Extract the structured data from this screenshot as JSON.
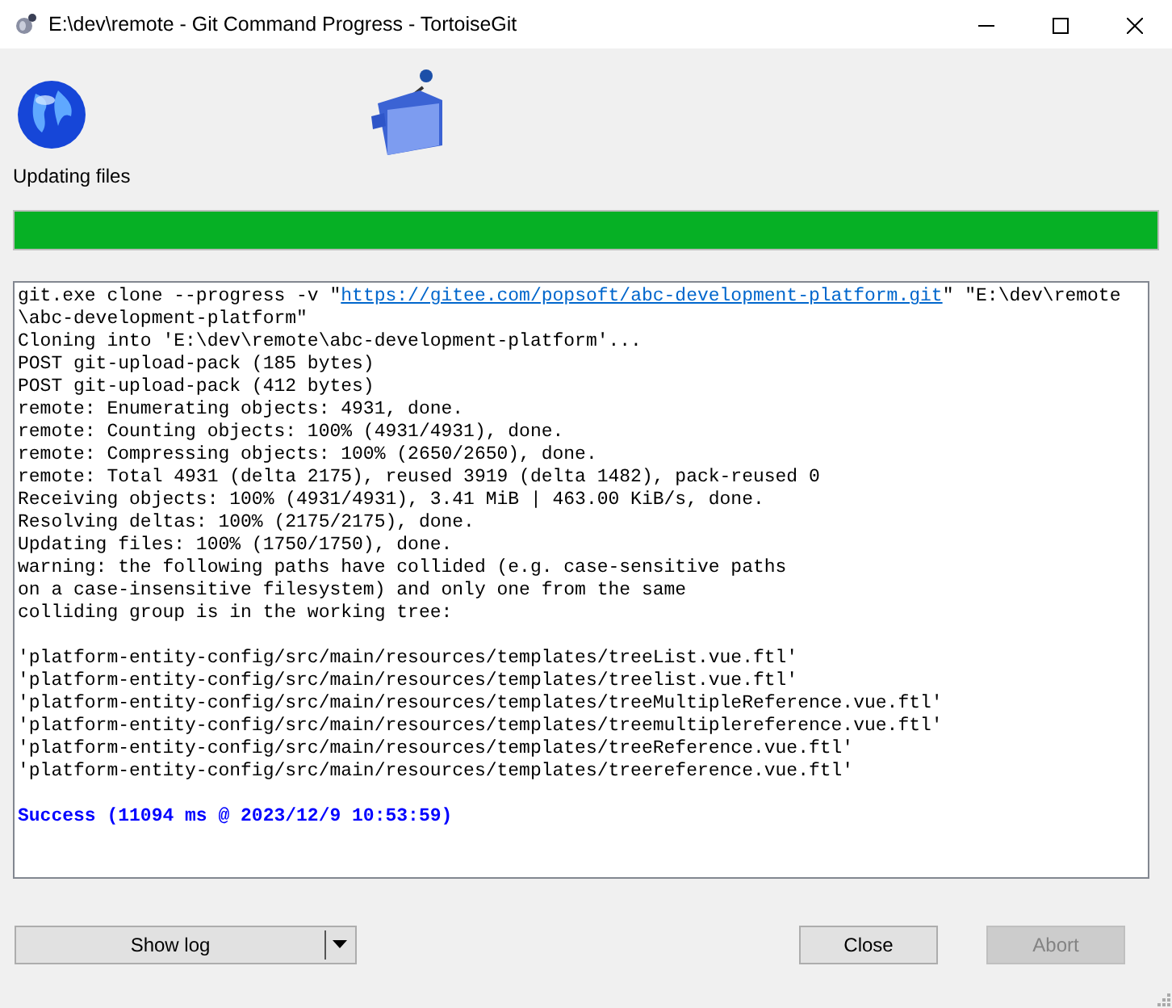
{
  "window": {
    "title": "E:\\dev\\remote - Git Command Progress - TortoiseGit"
  },
  "status": {
    "text": "Updating files"
  },
  "progress": {
    "level": 1.0
  },
  "log": [
    {
      "kind": "command",
      "before": "git.exe clone --progress -v \"",
      "url": "https://gitee.com/popsoft/abc-development-platform.git",
      "after": "\" \"E:\\dev\\remote"
    },
    {
      "kind": "text",
      "text": "\\abc-development-platform\""
    },
    {
      "kind": "text",
      "text": "Cloning into 'E:\\dev\\remote\\abc-development-platform'..."
    },
    {
      "kind": "text",
      "text": "POST git-upload-pack (185 bytes)"
    },
    {
      "kind": "text",
      "text": "POST git-upload-pack (412 bytes)"
    },
    {
      "kind": "text",
      "text": "remote: Enumerating objects: 4931, done."
    },
    {
      "kind": "text",
      "text": "remote: Counting objects: 100% (4931/4931), done."
    },
    {
      "kind": "text",
      "text": "remote: Compressing objects: 100% (2650/2650), done."
    },
    {
      "kind": "text",
      "text": "remote: Total 4931 (delta 2175), reused 3919 (delta 1482), pack-reused 0"
    },
    {
      "kind": "text",
      "text": "Receiving objects: 100% (4931/4931), 3.41 MiB | 463.00 KiB/s, done."
    },
    {
      "kind": "text",
      "text": "Resolving deltas: 100% (2175/2175), done."
    },
    {
      "kind": "text",
      "text": "Updating files: 100% (1750/1750), done."
    },
    {
      "kind": "text",
      "text": "warning: the following paths have collided (e.g. case-sensitive paths"
    },
    {
      "kind": "text",
      "text": "on a case-insensitive filesystem) and only one from the same"
    },
    {
      "kind": "text",
      "text": "colliding group is in the working tree:"
    },
    {
      "kind": "blank"
    },
    {
      "kind": "text",
      "text": "'platform-entity-config/src/main/resources/templates/treeList.vue.ftl'"
    },
    {
      "kind": "text",
      "text": "'platform-entity-config/src/main/resources/templates/treelist.vue.ftl'"
    },
    {
      "kind": "text",
      "text": "'platform-entity-config/src/main/resources/templates/treeMultipleReference.vue.ftl'"
    },
    {
      "kind": "text",
      "text": "'platform-entity-config/src/main/resources/templates/treemultiplereference.vue.ftl'"
    },
    {
      "kind": "text",
      "text": "'platform-entity-config/src/main/resources/templates/treeReference.vue.ftl'"
    },
    {
      "kind": "text",
      "text": "'platform-entity-config/src/main/resources/templates/treereference.vue.ftl'"
    },
    {
      "kind": "blank"
    },
    {
      "kind": "success",
      "text": "Success (11094 ms @ 2023/12/9 10:53:59)"
    }
  ],
  "buttons": [
    {
      "kind": "split",
      "label": "Show log",
      "disabled": false
    },
    {
      "kind": "plain",
      "label": "Close",
      "disabled": false
    },
    {
      "kind": "plain",
      "label": "Abort",
      "disabled": true
    }
  ]
}
